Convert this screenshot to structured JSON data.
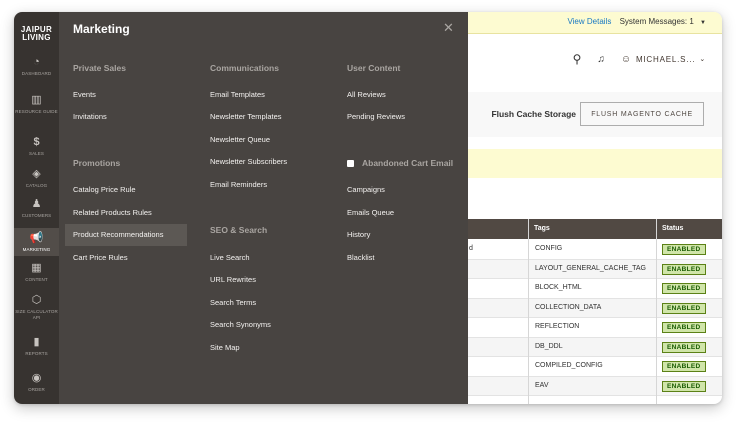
{
  "sidebar": {
    "logo_line1": "JAIPUR",
    "logo_line2": "LIVING",
    "items": [
      {
        "label": "DASHBOARD",
        "icon": "dashboard-icon"
      },
      {
        "label": "RESOURCE GUIDE",
        "icon": "book-icon"
      },
      {
        "label": "SALES",
        "icon": "dollar-icon"
      },
      {
        "label": "CATALOG",
        "icon": "cube-icon"
      },
      {
        "label": "CUSTOMERS",
        "icon": "person-icon"
      },
      {
        "label": "MARKETING",
        "icon": "megaphone-icon"
      },
      {
        "label": "CONTENT",
        "icon": "layout-icon"
      },
      {
        "label": "SIZE CALCULATOR API",
        "icon": "hexagon-icon"
      },
      {
        "label": "REPORTS",
        "icon": "bar-chart-icon"
      },
      {
        "label": "ORDER",
        "icon": "badge-icon"
      }
    ],
    "active": "MARKETING"
  },
  "notice": {
    "view_details": "View Details",
    "system_messages": "System Messages: 1"
  },
  "header": {
    "user": "MICHAEL.S..."
  },
  "cache": {
    "flush_label": "Flush Cache Storage",
    "flush_button": "FLUSH MAGENTO CACHE"
  },
  "grid": {
    "columns": [
      "Tags",
      "Status"
    ],
    "partial_char": "d",
    "rows": [
      {
        "tag": "CONFIG",
        "status": "ENABLED"
      },
      {
        "tag": "LAYOUT_GENERAL_CACHE_TAG",
        "status": "ENABLED"
      },
      {
        "tag": "BLOCK_HTML",
        "status": "ENABLED"
      },
      {
        "tag": "COLLECTION_DATA",
        "status": "ENABLED"
      },
      {
        "tag": "REFLECTION",
        "status": "ENABLED"
      },
      {
        "tag": "DB_DDL",
        "status": "ENABLED"
      },
      {
        "tag": "COMPILED_CONFIG",
        "status": "ENABLED"
      },
      {
        "tag": "EAV",
        "status": "ENABLED"
      }
    ]
  },
  "panel": {
    "title": "Marketing",
    "columns": [
      {
        "sections": [
          {
            "title": "Private Sales",
            "links": [
              "Events",
              "Invitations"
            ]
          },
          {
            "title": "Promotions",
            "links": [
              "Catalog Price Rule",
              "Related Products Rules",
              "Product Recommendations",
              "Cart Price Rules"
            ]
          }
        ]
      },
      {
        "sections": [
          {
            "title": "Communications",
            "links": [
              "Email Templates",
              "Newsletter Templates",
              "Newsletter Queue",
              "Newsletter Subscribers",
              "Email Reminders"
            ]
          },
          {
            "title": "SEO & Search",
            "links": [
              "Live Search",
              "URL Rewrites",
              "Search Terms",
              "Search Synonyms",
              "Site Map"
            ]
          }
        ]
      },
      {
        "sections": [
          {
            "title": "User Content",
            "links": [
              "All Reviews",
              "Pending Reviews"
            ]
          },
          {
            "title": "Abandoned Cart Email",
            "links": [
              "Campaigns",
              "Emails Queue",
              "History",
              "Blacklist"
            ]
          }
        ]
      }
    ],
    "highlighted": "Product Recommendations"
  }
}
